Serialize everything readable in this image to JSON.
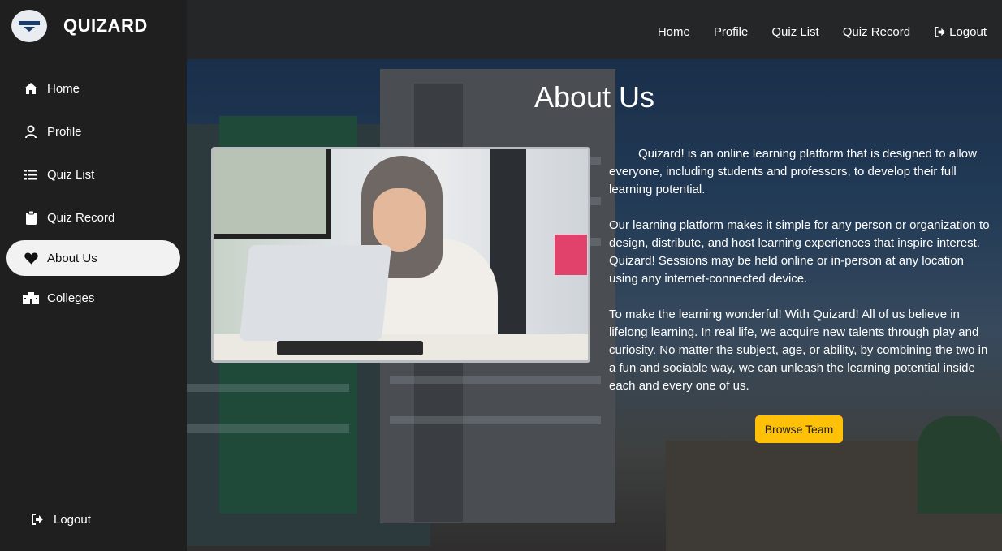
{
  "brand": {
    "name": "QUIZARD",
    "logo_icon": "quizard-logo-icon"
  },
  "sidebar": {
    "items": [
      {
        "label": "Home",
        "icon": "home-icon"
      },
      {
        "label": "Profile",
        "icon": "user-icon"
      },
      {
        "label": "Quiz List",
        "icon": "list-icon"
      },
      {
        "label": "Quiz Record",
        "icon": "clipboard-icon"
      },
      {
        "label": "About Us",
        "icon": "heart-icon",
        "active": true
      },
      {
        "label": "Colleges",
        "icon": "building-icon"
      }
    ],
    "logout": {
      "label": "Logout",
      "icon": "logout-icon"
    }
  },
  "topnav": {
    "home": "Home",
    "profile": "Profile",
    "quiz_list": "Quiz List",
    "quiz_record": "Quiz Record",
    "logout": "Logout"
  },
  "main": {
    "title": "About Us",
    "paragraphs": [
      "Quizard! is an online learning platform that is designed to allow everyone, including students and professors, to develop their full learning potential.",
      "Our learning platform makes it simple for any person or organization to design, distribute, and host learning experiences that inspire interest. Quizard! Sessions may be held online or in-person at any location using any internet-connected device.",
      "To make the learning wonderful! With Quizard! All of us believe in lifelong learning. In real life, we acquire new talents through play and curiosity. No matter the subject, age, or ability, by combining the two in a fun and sociable way, we can unleash the learning potential inside each and every one of us."
    ],
    "button_label": "Browse Team"
  },
  "colors": {
    "accent": "#ffc107",
    "sidebar_bg": "#1f1f1f",
    "topbar_bg": "#242628"
  }
}
